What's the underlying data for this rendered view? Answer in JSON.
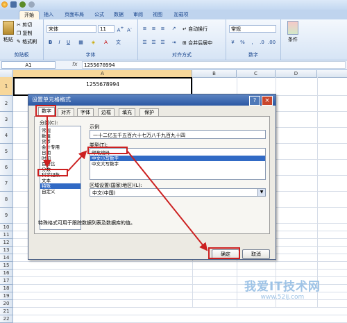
{
  "ribbon": {
    "tabs": [
      "开始",
      "插入",
      "页面布局",
      "公式",
      "数据",
      "审阅",
      "视图",
      "加载项"
    ],
    "clipboard": {
      "paste": "粘贴",
      "cut": "剪切",
      "copy": "复制",
      "format_painter": "格式刷",
      "group": "剪贴板"
    },
    "font": {
      "name": "宋体",
      "size": "11",
      "group": "字体"
    },
    "alignment": {
      "wrap": "自动换行",
      "merge": "合并后居中",
      "group": "对齐方式"
    },
    "number": {
      "format": "常规",
      "group": "数字"
    },
    "styles": {
      "conditional": "条件"
    }
  },
  "formula_bar": {
    "name_box": "A1",
    "fx": "fx",
    "value": "1255678994"
  },
  "sheet": {
    "columns": [
      "A",
      "B",
      "C",
      "D"
    ],
    "rows": [
      "1",
      "2",
      "3",
      "4",
      "5",
      "6",
      "7",
      "8",
      "9",
      "10",
      "11",
      "12",
      "13",
      "14",
      "15",
      "16",
      "17",
      "18",
      "19",
      "20",
      "21",
      "22"
    ],
    "a1_value": "1255678994"
  },
  "dialog": {
    "title": "设置单元格格式",
    "tabs": [
      "数字",
      "对齐",
      "字体",
      "边框",
      "填充",
      "保护"
    ],
    "category_label": "分类(C):",
    "categories": [
      "常规",
      "数值",
      "货币",
      "会计专用",
      "日期",
      "时间",
      "百分比",
      "分数",
      "科学记数",
      "文本",
      "特殊",
      "自定义"
    ],
    "selected_category": "特殊",
    "sample_label": "示例",
    "sample_value": "一十二亿五千五百六十七万八千九百九十四",
    "type_label": "类型(T):",
    "types": [
      "邮政编码",
      "中文小写数字",
      "中文大写数字"
    ],
    "selected_type": "中文小写数字",
    "locale_label": "区域设置(国家/地区)(L):",
    "locale_value": "中文(中国)",
    "description": "特殊格式可用于跟踪数据列表及数据库的值。",
    "ok": "确定",
    "cancel": "取消",
    "help": "?",
    "close": "×"
  },
  "watermark": {
    "text": "我爱IT技术网",
    "url": "www.52ij.com"
  }
}
